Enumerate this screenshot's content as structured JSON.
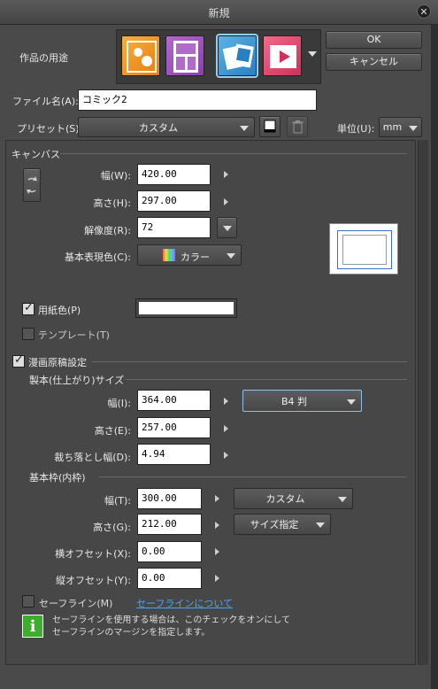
{
  "window": {
    "title": "新規"
  },
  "purpose": {
    "label": "作品の用途"
  },
  "buttons": {
    "ok": "OK",
    "cancel": "キャンセル"
  },
  "file": {
    "label": "ファイル名(A):",
    "value": "コミック2"
  },
  "preset": {
    "label": "プリセット(S):",
    "value": "カスタム"
  },
  "unit": {
    "label": "単位(U):",
    "value": "mm"
  },
  "canvas": {
    "section": "キャンバス",
    "width_label": "幅(W):",
    "width_value": "420.00",
    "height_label": "高さ(H):",
    "height_value": "297.00",
    "resolution_label": "解像度(R):",
    "resolution_value": "72",
    "color_label": "基本表現色(C):",
    "color_value": "カラー"
  },
  "paper": {
    "label": "用紙色(P)",
    "color": "#ffffff"
  },
  "template": {
    "label": "テンプレート(T)"
  },
  "manga": {
    "label": "漫画原稿設定",
    "finish_section": "製本(仕上がり)サイズ",
    "width_label": "幅(I):",
    "width_value": "364.00",
    "height_label": "高さ(E):",
    "height_value": "257.00",
    "bleed_label": "裁ち落とし幅(D):",
    "bleed_value": "4.94",
    "size_preset": "B4 判",
    "inner_section": "基本枠(内枠)",
    "inner_width_label": "幅(T):",
    "inner_width_value": "300.00",
    "inner_height_label": "高さ(G):",
    "inner_height_value": "212.00",
    "inner_preset": "カスタム",
    "inner_mode": "サイズ指定",
    "xoffset_label": "横オフセット(X):",
    "xoffset_value": "0.00",
    "yoffset_label": "縦オフセット(Y):",
    "yoffset_value": "0.00"
  },
  "safeline": {
    "label": "セーフライン(M)",
    "link": "セーフラインについて",
    "info_line1": "セーフラインを使用する場合は、このチェックをオンにして",
    "info_line2": "セーフラインのマージンを指定します。"
  },
  "colors": {
    "accent_link": "#4aa3ff",
    "info_green": "#3cae2c"
  }
}
